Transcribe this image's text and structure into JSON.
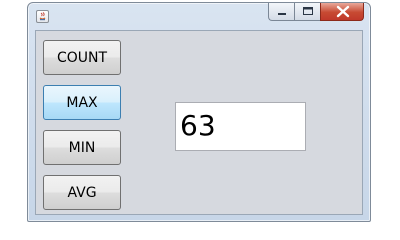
{
  "window": {
    "title": "",
    "controls": [
      "minimize-icon",
      "maximize-icon",
      "close-icon"
    ]
  },
  "buttons": {
    "count_label": "COUNT",
    "max_label": "MAX",
    "min_label": "MIN",
    "avg_label": "AVG"
  },
  "result": {
    "value": "63"
  },
  "colors": {
    "client_background": "#d6d9df",
    "frame": "#c7d6e8",
    "close_button": "#c74a32",
    "focused_button": "#bee6fd"
  }
}
